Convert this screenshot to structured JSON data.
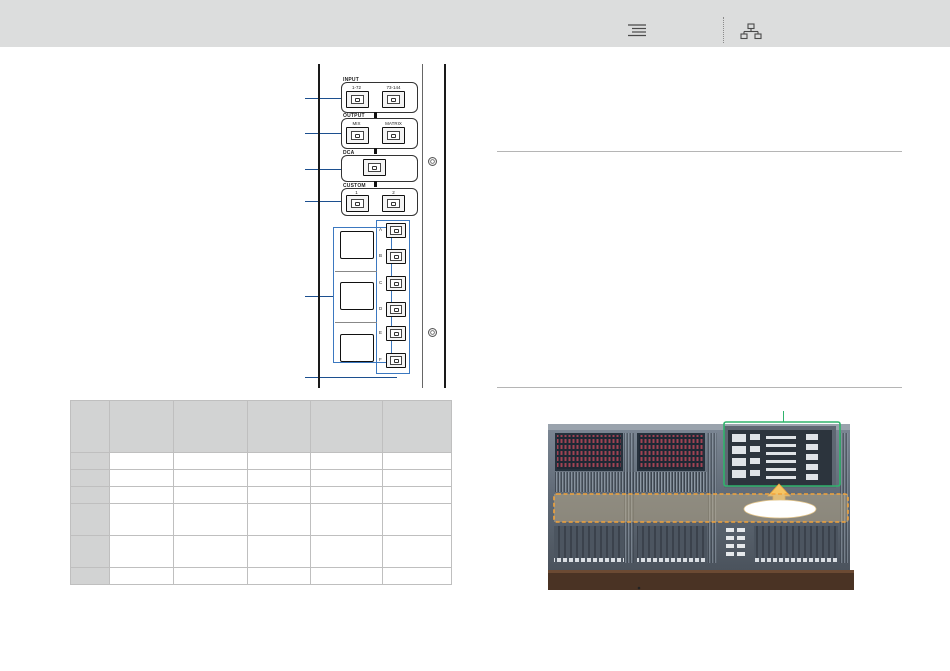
{
  "toolbar": {
    "toc_icon": "toc-list-icon",
    "sitemap_icon": "sitemap-icon"
  },
  "panel": {
    "input": {
      "label": "INPUT",
      "keys": [
        "1-72",
        "73-144"
      ]
    },
    "output": {
      "label": "OUTPUT",
      "keys": [
        "MIX",
        "MATRIX"
      ]
    },
    "dca": {
      "label": "DCA"
    },
    "custom": {
      "label": "CUSTOM",
      "keys": [
        "1",
        "2"
      ]
    },
    "bank": {
      "keys": [
        "A",
        "B",
        "C",
        "D",
        "E",
        "F"
      ]
    }
  },
  "colors": {
    "callout": "#1c4f8f",
    "highlight_green": "#2fb36c",
    "highlight_orange": "#f2a33a",
    "toolbar_bg": "#dcdddd",
    "table_header_bg": "#d2d3d3"
  }
}
